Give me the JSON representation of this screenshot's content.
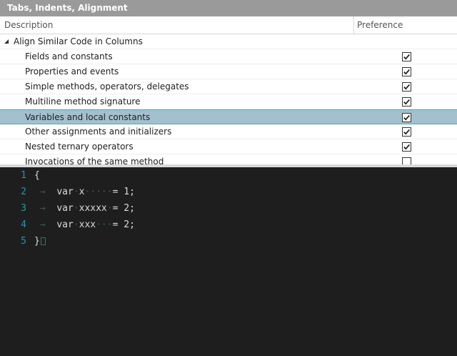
{
  "panel": {
    "title": "Tabs, Indents, Alignment"
  },
  "grid": {
    "columns": {
      "description": "Description",
      "preference": "Preference"
    },
    "group": {
      "label": "Align Similar Code in Columns",
      "expanded": true
    },
    "rows": [
      {
        "label": "Fields and constants",
        "checked": true
      },
      {
        "label": "Properties and events",
        "checked": true
      },
      {
        "label": "Simple methods, operators, delegates",
        "checked": true
      },
      {
        "label": "Multiline method signature",
        "checked": true
      },
      {
        "label": "Variables and local constants",
        "checked": true,
        "selected": true
      },
      {
        "label": "Other assignments and initializers",
        "checked": true
      },
      {
        "label": "Nested ternary operators",
        "checked": true
      },
      {
        "label": "Invocations of the same method",
        "checked": false
      }
    ]
  },
  "editor": {
    "lines": [
      {
        "number": "1",
        "text": "{"
      },
      {
        "number": "2",
        "kw": "var",
        "ident": "x",
        "rest": "= 1;"
      },
      {
        "number": "3",
        "kw": "var",
        "ident": "xxxxx",
        "rest": "= 2;"
      },
      {
        "number": "4",
        "kw": "var",
        "ident": "xxx",
        "rest": "= 2;"
      },
      {
        "number": "5",
        "text": "}"
      }
    ]
  },
  "colors": {
    "title_bar": "#9a9a9a",
    "selection": "#a3c0cf",
    "editor_bg": "#1e1e1e",
    "line_number": "#2b91af"
  }
}
